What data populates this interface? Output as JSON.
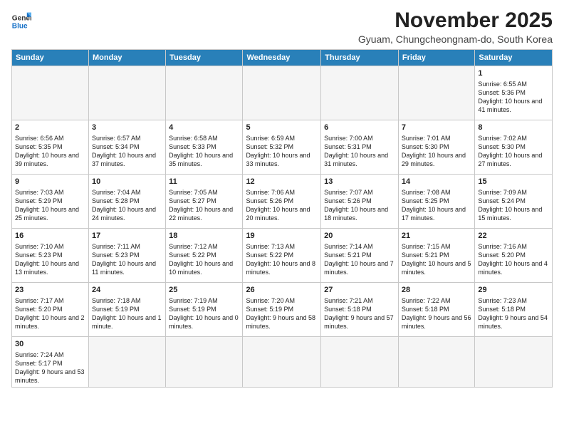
{
  "logo": {
    "line1": "General",
    "line2": "Blue"
  },
  "title": "November 2025",
  "location": "Gyuam, Chungcheongnam-do, South Korea",
  "days_of_week": [
    "Sunday",
    "Monday",
    "Tuesday",
    "Wednesday",
    "Thursday",
    "Friday",
    "Saturday"
  ],
  "weeks": [
    [
      {
        "day": "",
        "info": ""
      },
      {
        "day": "",
        "info": ""
      },
      {
        "day": "",
        "info": ""
      },
      {
        "day": "",
        "info": ""
      },
      {
        "day": "",
        "info": ""
      },
      {
        "day": "",
        "info": ""
      },
      {
        "day": "1",
        "info": "Sunrise: 6:55 AM\nSunset: 5:36 PM\nDaylight: 10 hours and 41 minutes."
      }
    ],
    [
      {
        "day": "2",
        "info": "Sunrise: 6:56 AM\nSunset: 5:35 PM\nDaylight: 10 hours and 39 minutes."
      },
      {
        "day": "3",
        "info": "Sunrise: 6:57 AM\nSunset: 5:34 PM\nDaylight: 10 hours and 37 minutes."
      },
      {
        "day": "4",
        "info": "Sunrise: 6:58 AM\nSunset: 5:33 PM\nDaylight: 10 hours and 35 minutes."
      },
      {
        "day": "5",
        "info": "Sunrise: 6:59 AM\nSunset: 5:32 PM\nDaylight: 10 hours and 33 minutes."
      },
      {
        "day": "6",
        "info": "Sunrise: 7:00 AM\nSunset: 5:31 PM\nDaylight: 10 hours and 31 minutes."
      },
      {
        "day": "7",
        "info": "Sunrise: 7:01 AM\nSunset: 5:30 PM\nDaylight: 10 hours and 29 minutes."
      },
      {
        "day": "8",
        "info": "Sunrise: 7:02 AM\nSunset: 5:30 PM\nDaylight: 10 hours and 27 minutes."
      }
    ],
    [
      {
        "day": "9",
        "info": "Sunrise: 7:03 AM\nSunset: 5:29 PM\nDaylight: 10 hours and 25 minutes."
      },
      {
        "day": "10",
        "info": "Sunrise: 7:04 AM\nSunset: 5:28 PM\nDaylight: 10 hours and 24 minutes."
      },
      {
        "day": "11",
        "info": "Sunrise: 7:05 AM\nSunset: 5:27 PM\nDaylight: 10 hours and 22 minutes."
      },
      {
        "day": "12",
        "info": "Sunrise: 7:06 AM\nSunset: 5:26 PM\nDaylight: 10 hours and 20 minutes."
      },
      {
        "day": "13",
        "info": "Sunrise: 7:07 AM\nSunset: 5:26 PM\nDaylight: 10 hours and 18 minutes."
      },
      {
        "day": "14",
        "info": "Sunrise: 7:08 AM\nSunset: 5:25 PM\nDaylight: 10 hours and 17 minutes."
      },
      {
        "day": "15",
        "info": "Sunrise: 7:09 AM\nSunset: 5:24 PM\nDaylight: 10 hours and 15 minutes."
      }
    ],
    [
      {
        "day": "16",
        "info": "Sunrise: 7:10 AM\nSunset: 5:23 PM\nDaylight: 10 hours and 13 minutes."
      },
      {
        "day": "17",
        "info": "Sunrise: 7:11 AM\nSunset: 5:23 PM\nDaylight: 10 hours and 11 minutes."
      },
      {
        "day": "18",
        "info": "Sunrise: 7:12 AM\nSunset: 5:22 PM\nDaylight: 10 hours and 10 minutes."
      },
      {
        "day": "19",
        "info": "Sunrise: 7:13 AM\nSunset: 5:22 PM\nDaylight: 10 hours and 8 minutes."
      },
      {
        "day": "20",
        "info": "Sunrise: 7:14 AM\nSunset: 5:21 PM\nDaylight: 10 hours and 7 minutes."
      },
      {
        "day": "21",
        "info": "Sunrise: 7:15 AM\nSunset: 5:21 PM\nDaylight: 10 hours and 5 minutes."
      },
      {
        "day": "22",
        "info": "Sunrise: 7:16 AM\nSunset: 5:20 PM\nDaylight: 10 hours and 4 minutes."
      }
    ],
    [
      {
        "day": "23",
        "info": "Sunrise: 7:17 AM\nSunset: 5:20 PM\nDaylight: 10 hours and 2 minutes."
      },
      {
        "day": "24",
        "info": "Sunrise: 7:18 AM\nSunset: 5:19 PM\nDaylight: 10 hours and 1 minute."
      },
      {
        "day": "25",
        "info": "Sunrise: 7:19 AM\nSunset: 5:19 PM\nDaylight: 10 hours and 0 minutes."
      },
      {
        "day": "26",
        "info": "Sunrise: 7:20 AM\nSunset: 5:19 PM\nDaylight: 9 hours and 58 minutes."
      },
      {
        "day": "27",
        "info": "Sunrise: 7:21 AM\nSunset: 5:18 PM\nDaylight: 9 hours and 57 minutes."
      },
      {
        "day": "28",
        "info": "Sunrise: 7:22 AM\nSunset: 5:18 PM\nDaylight: 9 hours and 56 minutes."
      },
      {
        "day": "29",
        "info": "Sunrise: 7:23 AM\nSunset: 5:18 PM\nDaylight: 9 hours and 54 minutes."
      }
    ],
    [
      {
        "day": "30",
        "info": "Sunrise: 7:24 AM\nSunset: 5:17 PM\nDaylight: 9 hours and 53 minutes."
      },
      {
        "day": "",
        "info": ""
      },
      {
        "day": "",
        "info": ""
      },
      {
        "day": "",
        "info": ""
      },
      {
        "day": "",
        "info": ""
      },
      {
        "day": "",
        "info": ""
      },
      {
        "day": "",
        "info": ""
      }
    ]
  ]
}
